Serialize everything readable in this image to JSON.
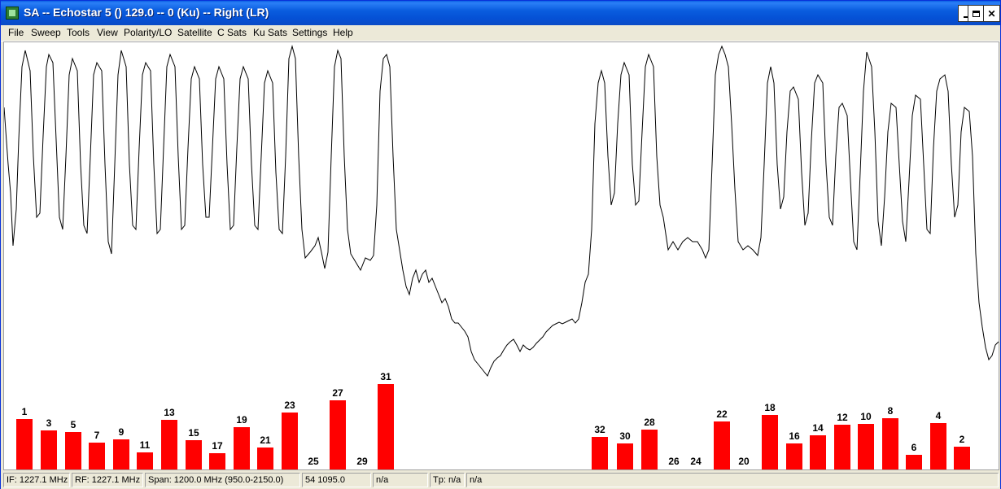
{
  "window": {
    "title": "SA -- Echostar 5 () 129.0 -- 0 (Ku) -- Right (LR)"
  },
  "titlebar_buttons": {
    "close_glyph": "✕"
  },
  "menu": [
    {
      "label": "File"
    },
    {
      "label": "Sweep"
    },
    {
      "label": "Tools"
    },
    {
      "label": "View"
    },
    {
      "label": "Polarity/LO"
    },
    {
      "label": "Satellite"
    },
    {
      "label": "C Sats"
    },
    {
      "label": "Ku Sats"
    },
    {
      "label": "Settings"
    },
    {
      "label": "Help"
    }
  ],
  "chart_data": {
    "type": "bar",
    "title": "",
    "series": [
      {
        "color": "#FF0000",
        "points": [
          {
            "label": "1",
            "value": 62
          },
          {
            "label": "3",
            "value": 48
          },
          {
            "label": "5",
            "value": 46
          },
          {
            "label": "7",
            "value": 33
          },
          {
            "label": "9",
            "value": 37
          },
          {
            "label": "11",
            "value": 21
          },
          {
            "label": "13",
            "value": 61
          },
          {
            "label": "15",
            "value": 36
          },
          {
            "label": "17",
            "value": 20
          },
          {
            "label": "19",
            "value": 52
          },
          {
            "label": "21",
            "value": 27
          },
          {
            "label": "23",
            "value": 70
          },
          {
            "label": "25",
            "value": 0
          },
          {
            "label": "27",
            "value": 85
          },
          {
            "label": "29",
            "value": 0
          },
          {
            "label": "31",
            "value": 105
          },
          {
            "label": "32",
            "value": 40
          },
          {
            "label": "30",
            "value": 32
          },
          {
            "label": "28",
            "value": 49
          },
          {
            "label": "26",
            "value": 0
          },
          {
            "label": "24",
            "value": 0
          },
          {
            "label": "22",
            "value": 59
          },
          {
            "label": "20",
            "value": 0
          },
          {
            "label": "18",
            "value": 67
          },
          {
            "label": "16",
            "value": 32
          },
          {
            "label": "14",
            "value": 42
          },
          {
            "label": "12",
            "value": 55
          },
          {
            "label": "10",
            "value": 56
          },
          {
            "label": "8",
            "value": 63
          },
          {
            "label": "6",
            "value": 18
          },
          {
            "label": "4",
            "value": 57
          },
          {
            "label": "2",
            "value": 28
          }
        ]
      }
    ],
    "grid": false,
    "legend": "none"
  },
  "status": {
    "if": "IF: 1227.1 MHz",
    "rf": "RF: 1227.1 MHz",
    "span": "Span: 1200.0 MHz (950.0-2150.0)",
    "marker": "54 1095.0",
    "field5": "n/a",
    "tp": "Tp: n/a",
    "field7": "n/a"
  }
}
